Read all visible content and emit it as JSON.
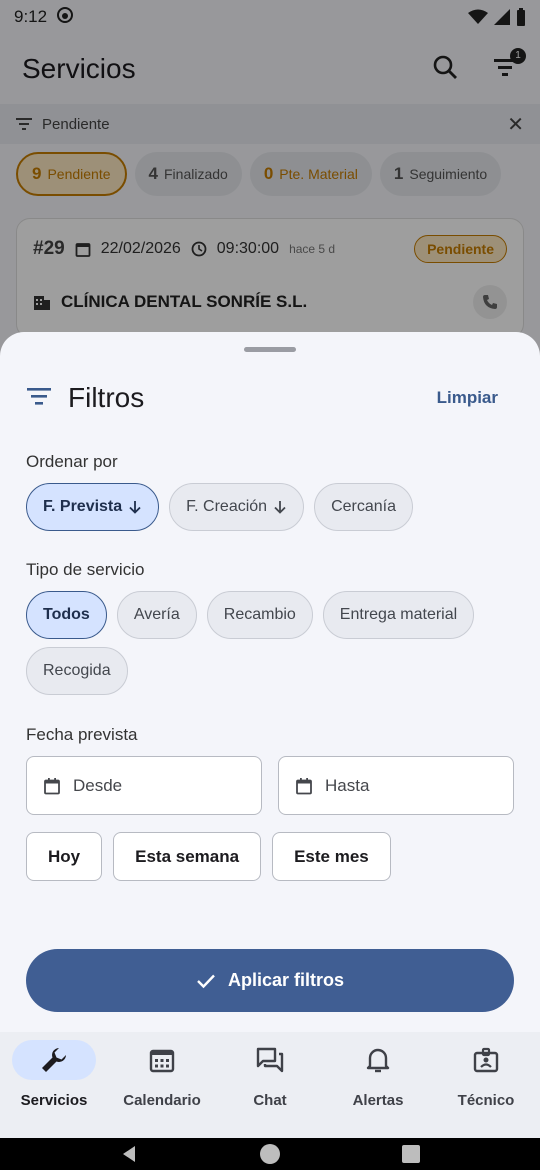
{
  "status_bar": {
    "time": "9:12"
  },
  "app_bar": {
    "title": "Servicios",
    "filter_badge": "1"
  },
  "active_filter_bar": {
    "label": "Pendiente"
  },
  "status_chips": [
    {
      "count": "9",
      "label": "Pendiente"
    },
    {
      "count": "4",
      "label": "Finalizado"
    },
    {
      "count": "0",
      "label": "Pte. Material"
    },
    {
      "count": "1",
      "label": "Seguimiento"
    }
  ],
  "service_card": {
    "number": "#29",
    "date": "22/02/2026",
    "time": "09:30:00",
    "ago": "hace 5 d",
    "status": "Pendiente",
    "client": "CLÍNICA DENTAL SONRÍE S.L."
  },
  "sheet": {
    "title": "Filtros",
    "clear_label": "Limpiar",
    "sort": {
      "label": "Ordenar por",
      "options": [
        "F. Prevista",
        "F. Creación",
        "Cercanía"
      ],
      "selected": "F. Prevista"
    },
    "type": {
      "label": "Tipo de servicio",
      "options": [
        "Todos",
        "Avería",
        "Recambio",
        "Entrega material",
        "Recogida"
      ],
      "selected": "Todos"
    },
    "date": {
      "label": "Fecha prevista",
      "from_placeholder": "Desde",
      "to_placeholder": "Hasta",
      "quick": [
        "Hoy",
        "Esta semana",
        "Este mes"
      ]
    },
    "apply_label": "Aplicar filtros"
  },
  "bottom_nav": [
    {
      "label": "Servicios",
      "icon": "wrench-icon",
      "active": true
    },
    {
      "label": "Calendario",
      "icon": "calendar-icon",
      "active": false
    },
    {
      "label": "Chat",
      "icon": "chat-icon",
      "active": false
    },
    {
      "label": "Alertas",
      "icon": "bell-icon",
      "active": false
    },
    {
      "label": "Técnico",
      "icon": "badge-icon",
      "active": false
    }
  ],
  "colors": {
    "primary": "#405e93",
    "selected_chip": "#d5e3ff",
    "pending": "#c67c00"
  }
}
